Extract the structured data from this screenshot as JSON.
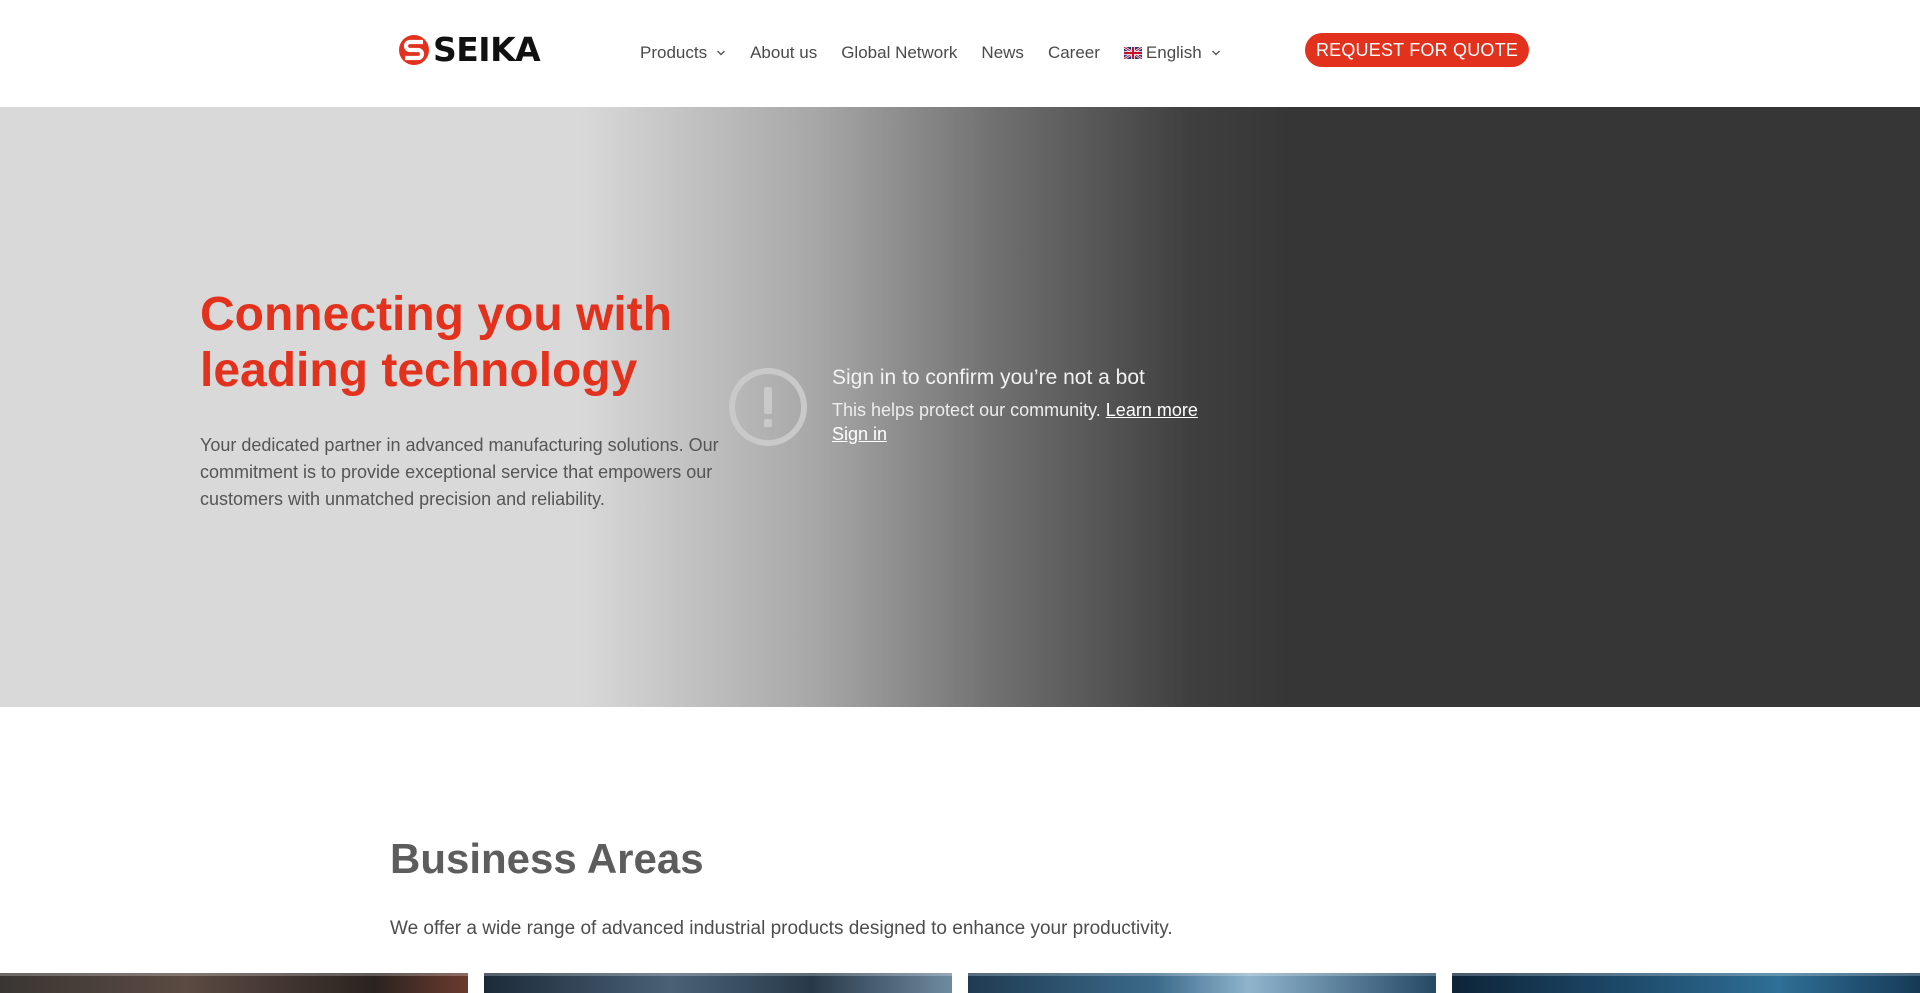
{
  "brand": {
    "name": "SEIKA",
    "accent": "#e2311d",
    "icon": "seika-logo-mark"
  },
  "nav": {
    "items": [
      {
        "label": "Products",
        "has_dropdown": true
      },
      {
        "label": "About us",
        "has_dropdown": false
      },
      {
        "label": "Global Network",
        "has_dropdown": false
      },
      {
        "label": "News",
        "has_dropdown": false
      },
      {
        "label": "Career",
        "has_dropdown": false
      }
    ],
    "language": {
      "label": "English",
      "icon": "uk-flag-icon",
      "has_dropdown": true
    },
    "cta_label": "REQUEST FOR QUOTE"
  },
  "hero": {
    "title": "Connecting you with leading technology",
    "text": "Your dedicated partner in advanced manufacturing solutions. Our commitment is to provide exceptional service that empowers our customers with unmatched precision and reliability."
  },
  "bot_check": {
    "icon": "exclamation-circle-icon",
    "title": "Sign in to confirm you’re not a bot",
    "text": "This helps protect our community.",
    "learn_more": "Learn more",
    "sign_in": "Sign in"
  },
  "business_areas": {
    "title": "Business Areas",
    "text": "We offer a wide range of advanced industrial products designed to enhance your productivity.",
    "cards": [
      {
        "name": "business-card-1"
      },
      {
        "name": "business-card-2"
      },
      {
        "name": "business-card-3"
      },
      {
        "name": "business-card-4"
      }
    ]
  }
}
